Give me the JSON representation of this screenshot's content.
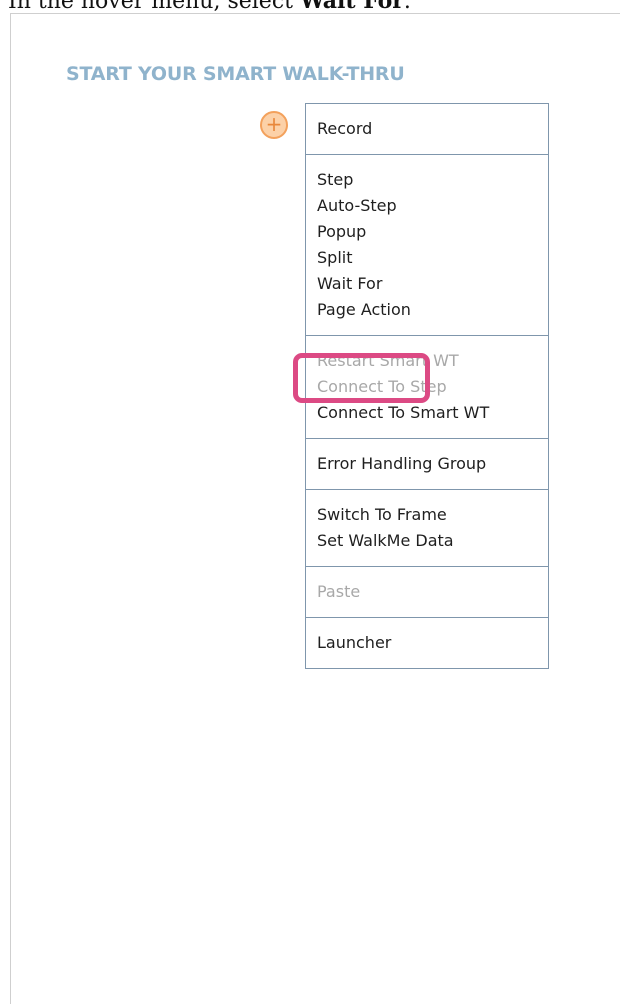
{
  "instruction": {
    "prefix": "In the hover menu, select ",
    "target": "Wait For",
    "suffix": "."
  },
  "section_title": "START YOUR SMART WALK-THRU",
  "add_button": {
    "icon": "plus-circle-icon",
    "label": "+"
  },
  "menu": {
    "groups": [
      {
        "items": [
          {
            "label": "Record",
            "disabled": false
          }
        ]
      },
      {
        "items": [
          {
            "label": "Step",
            "disabled": false
          },
          {
            "label": "Auto-Step",
            "disabled": false
          },
          {
            "label": "Popup",
            "disabled": false
          },
          {
            "label": "Split",
            "disabled": false
          },
          {
            "label": "Wait For",
            "disabled": false,
            "highlighted": true
          },
          {
            "label": "Page Action",
            "disabled": false
          }
        ]
      },
      {
        "items": [
          {
            "label": "Restart Smart WT",
            "disabled": true
          },
          {
            "label": "Connect To Step",
            "disabled": true
          },
          {
            "label": "Connect To Smart WT",
            "disabled": false
          }
        ]
      },
      {
        "items": [
          {
            "label": "Error Handling Group",
            "disabled": false
          }
        ]
      },
      {
        "items": [
          {
            "label": "Switch To Frame",
            "disabled": false
          },
          {
            "label": "Set WalkMe Data",
            "disabled": false
          }
        ]
      },
      {
        "items": [
          {
            "label": "Paste",
            "disabled": true
          }
        ]
      },
      {
        "items": [
          {
            "label": "Launcher",
            "disabled": false
          }
        ]
      }
    ]
  },
  "colors": {
    "title": "#8fb3cc",
    "menu_border": "#7f96ac",
    "highlight": "#dc4a84",
    "add_fill": "#fcd1a8",
    "add_stroke": "#f3a15c",
    "disabled_text": "#a8a8a8"
  }
}
